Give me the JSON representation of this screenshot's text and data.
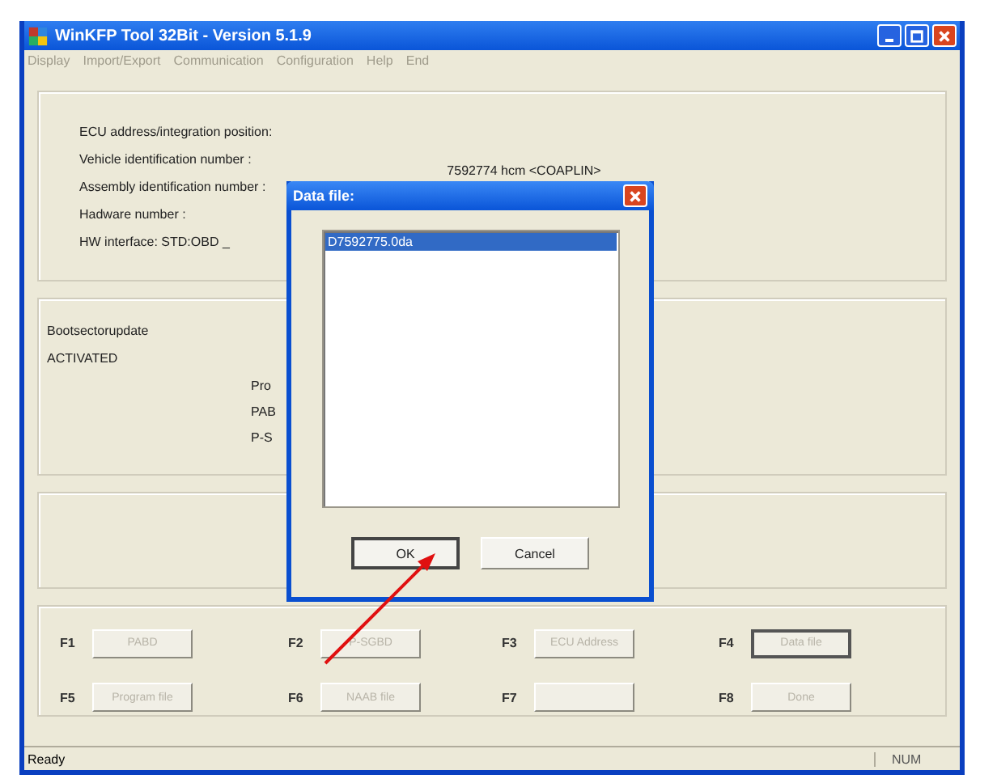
{
  "window": {
    "title": "WinKFP Tool 32Bit - Version 5.1.9"
  },
  "menu": [
    "Display",
    "Import/Export",
    "Communication",
    "Configuration",
    "Help",
    "End"
  ],
  "info_panel": {
    "lines": [
      "ECU address/integration position:",
      "Vehicle identification number :",
      "Assembly identification number :",
      "Hadware number :",
      "HW interface: STD:OBD _"
    ],
    "assembly_value": "7592774   hcm   <COAPLIN>"
  },
  "status_panel": {
    "lines": [
      "Bootsectorupdate",
      "ACTIVATED"
    ],
    "cut_labels": [
      "Pro",
      "PAB",
      "P-S"
    ]
  },
  "function_keys": [
    {
      "key": "F1",
      "label": "PABD",
      "disabled": true,
      "focused": false
    },
    {
      "key": "F2",
      "label": "P-SGBD",
      "disabled": true,
      "focused": false
    },
    {
      "key": "F3",
      "label": "ECU Address",
      "disabled": true,
      "focused": false
    },
    {
      "key": "F4",
      "label": "Data file",
      "disabled": true,
      "focused": true
    },
    {
      "key": "F5",
      "label": "Program file",
      "disabled": true,
      "focused": false
    },
    {
      "key": "F6",
      "label": "NAAB file",
      "disabled": true,
      "focused": false
    },
    {
      "key": "F7",
      "disabled": true,
      "focused": false
    },
    {
      "key": "F8",
      "label": "Done",
      "disabled": true,
      "focused": false
    }
  ],
  "dialog": {
    "title": "Data file:",
    "files": [
      {
        "name": "D7592775.0da",
        "selected": true
      }
    ],
    "buttons": [
      {
        "label": "OK",
        "default": true
      },
      {
        "label": "Cancel",
        "default": false
      }
    ]
  },
  "status_bar": {
    "text": "Ready",
    "indicator": "NUM"
  }
}
